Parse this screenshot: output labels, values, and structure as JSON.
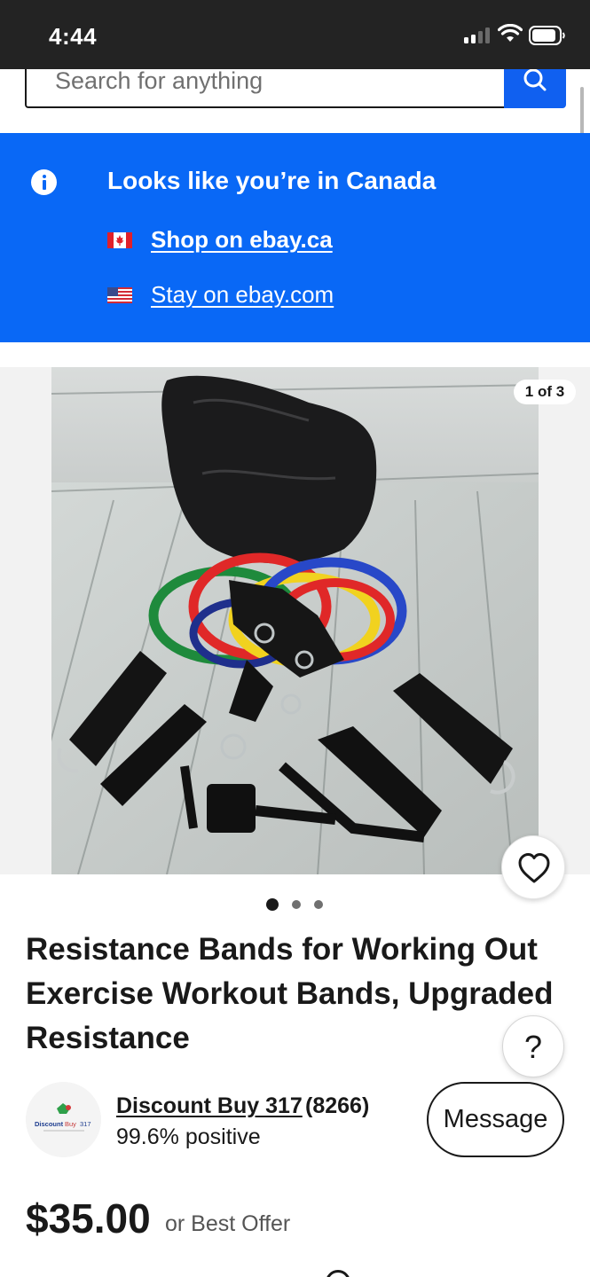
{
  "status_bar": {
    "time": "4:44"
  },
  "search": {
    "placeholder": "Search for anything"
  },
  "banner": {
    "title": "Looks like you’re in Canada",
    "links": [
      {
        "label": "Shop on ebay.ca",
        "icon": "canada-flag-icon"
      },
      {
        "label": "Stay on ebay.com",
        "icon": "us-flag-icon"
      }
    ]
  },
  "gallery": {
    "counter": "1 of 3",
    "dots": 3,
    "active_dot": 0
  },
  "listing": {
    "title": "Resistance Bands for Working Out Exercise Workout Bands, Upgraded Resistance",
    "help_label": "?"
  },
  "seller": {
    "name": "Discount Buy 317",
    "feedback_count": "(8266)",
    "feedback_percent": "99.6% positive",
    "logo_text": "Discount Buy 317",
    "message_label": "Message"
  },
  "price": {
    "amount": "$35.00",
    "suffix": "or Best Offer"
  },
  "colors": {
    "ebay_blue": "#0968f6",
    "status_bar": "#232323",
    "text": "#191919"
  }
}
